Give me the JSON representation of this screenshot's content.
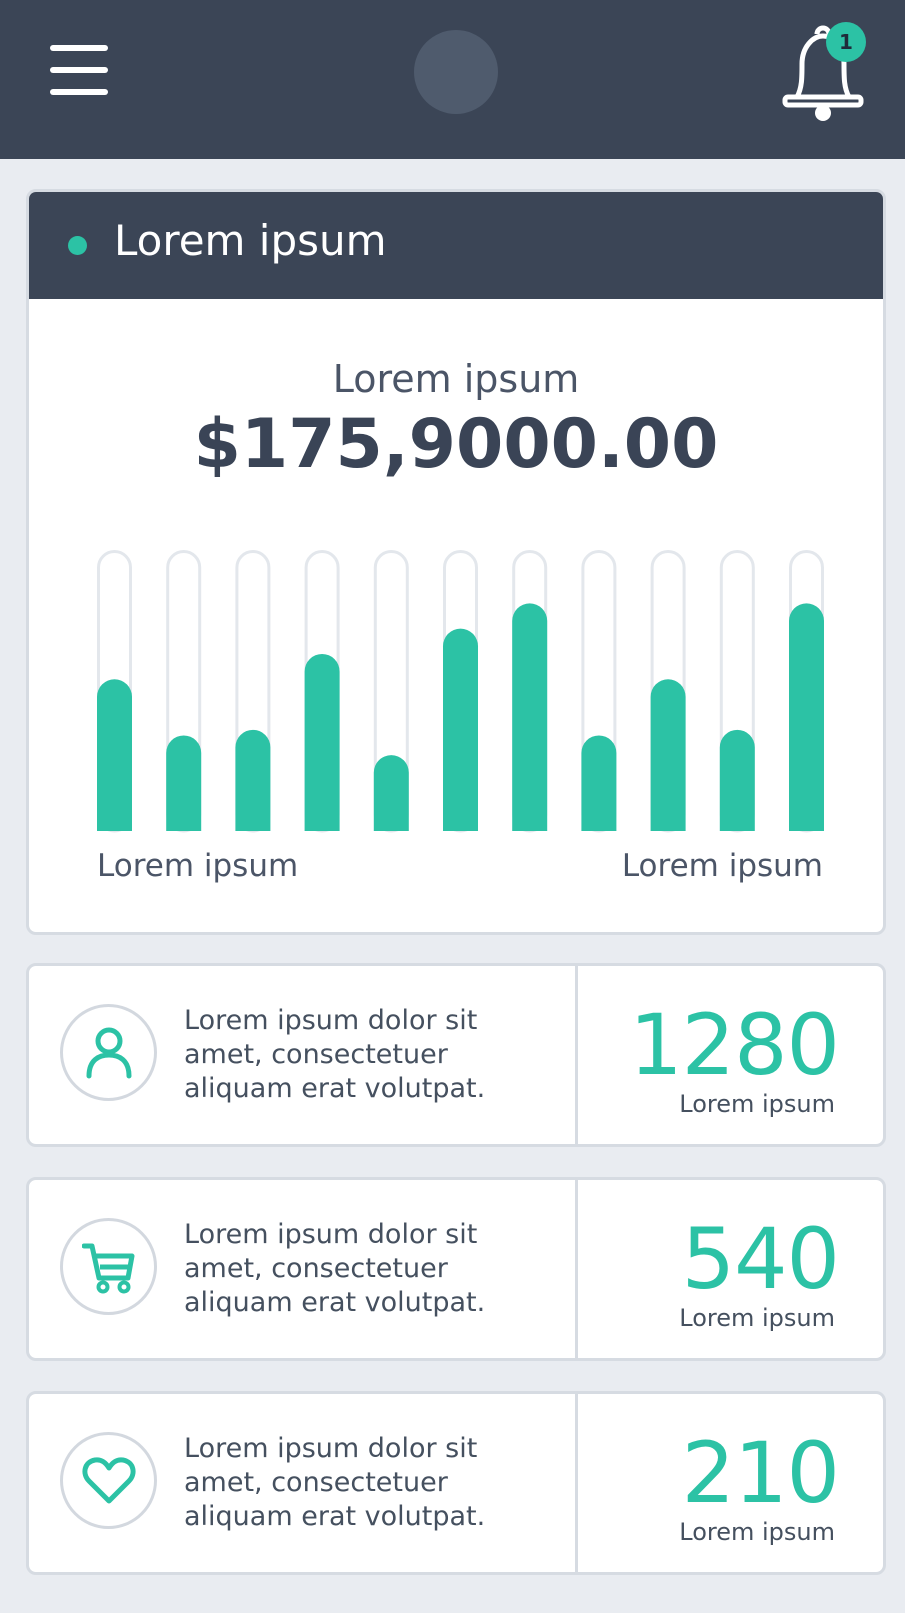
{
  "colors": {
    "accent": "#2cc2a5",
    "dark": "#3b4556",
    "track": "#e3e7ec",
    "background": "#e9ecf1"
  },
  "topbar": {
    "menu_icon": "hamburger-menu-icon",
    "bell_icon": "bell-icon",
    "notification_count": "1"
  },
  "summary": {
    "header_title": "Lorem ipsum",
    "label": "Lorem ipsum",
    "value": "$175,9000.00"
  },
  "chart_data": {
    "type": "bar",
    "title": "",
    "categories": [
      "",
      "",
      "",
      "",
      "",
      "",
      "",
      "",
      "",
      "",
      ""
    ],
    "values": [
      0.54,
      0.34,
      0.36,
      0.63,
      0.27,
      0.72,
      0.81,
      0.34,
      0.54,
      0.36,
      0.81
    ],
    "ylim": [
      0,
      1
    ],
    "x_start_label": "Lorem ipsum",
    "x_end_label": "Lorem ipsum"
  },
  "stats": [
    {
      "icon": "user-icon",
      "description": "Lorem ipsum dolor sit amet, consectetuer aliquam erat volutpat.",
      "value": "1280",
      "caption": "Lorem ipsum"
    },
    {
      "icon": "shopping-cart-icon",
      "description": "Lorem ipsum dolor sit amet, consectetuer aliquam erat volutpat.",
      "value": "540",
      "caption": "Lorem ipsum"
    },
    {
      "icon": "heart-icon",
      "description": "Lorem ipsum dolor sit amet, consectetuer aliquam erat volutpat.",
      "value": "210",
      "caption": "Lorem ipsum"
    }
  ]
}
